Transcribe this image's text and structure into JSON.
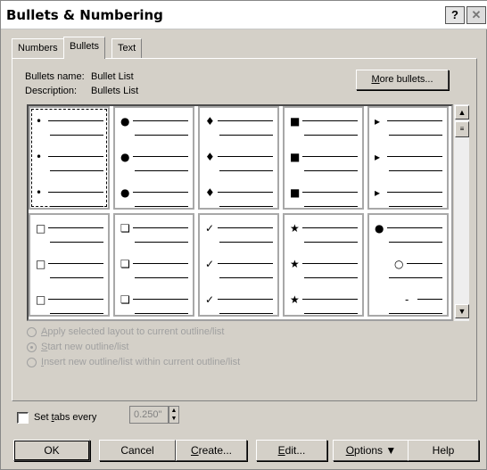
{
  "window": {
    "title": "Bullets & Numbering",
    "help_label": "?",
    "close_label": "✕"
  },
  "tabs": [
    {
      "label": "Numbers",
      "active": false
    },
    {
      "label": "Bullets",
      "active": true
    },
    {
      "label": "Text",
      "active": false
    }
  ],
  "info": {
    "name_label": "Bullets name:",
    "name_value": "Bullet List",
    "desc_label": "Description:",
    "desc_value": "Bullets List"
  },
  "more_bullets": {
    "mnemonic": "M",
    "rest": "ore bullets..."
  },
  "bullet_styles": [
    {
      "glyphs": [
        "•",
        "•",
        "•"
      ],
      "selected": true
    },
    {
      "glyphs": [
        "●",
        "●",
        "●"
      ],
      "selected": false
    },
    {
      "glyphs": [
        "♦",
        "♦",
        "♦"
      ],
      "selected": false
    },
    {
      "glyphs": [
        "■",
        "■",
        "■"
      ],
      "selected": false
    },
    {
      "glyphs": [
        "▸",
        "▸",
        "▸"
      ],
      "selected": false
    },
    {
      "glyphs": [
        "□",
        "□",
        "□"
      ],
      "selected": false
    },
    {
      "glyphs": [
        "❏",
        "❏",
        "❏"
      ],
      "selected": false
    },
    {
      "glyphs": [
        "✓",
        "✓",
        "✓"
      ],
      "selected": false
    },
    {
      "glyphs": [
        "★",
        "★",
        "★"
      ],
      "selected": false
    },
    {
      "glyphs": [
        "●",
        "○",
        "-"
      ],
      "selected": false
    }
  ],
  "options": [
    {
      "mnemonic": "A",
      "rest": "pply selected layout to current outline/list",
      "checked": false
    },
    {
      "mnemonic": "S",
      "rest": "tart new outline/list",
      "checked": true
    },
    {
      "mnemonic": "I",
      "rest": "nsert new outline/list within current outline/list",
      "checked": false
    }
  ],
  "tabs_setting": {
    "prefix": "Set ",
    "mnemonic": "t",
    "rest": "abs every",
    "value": "0.250\"",
    "checked": false
  },
  "buttons": {
    "ok": "OK",
    "cancel": "Cancel",
    "create": {
      "mnemonic": "C",
      "rest": "reate..."
    },
    "edit": {
      "mnemonic": "E",
      "rest": "dit..."
    },
    "options": {
      "mnemonic": "O",
      "rest": "ptions"
    },
    "help": "Help"
  }
}
